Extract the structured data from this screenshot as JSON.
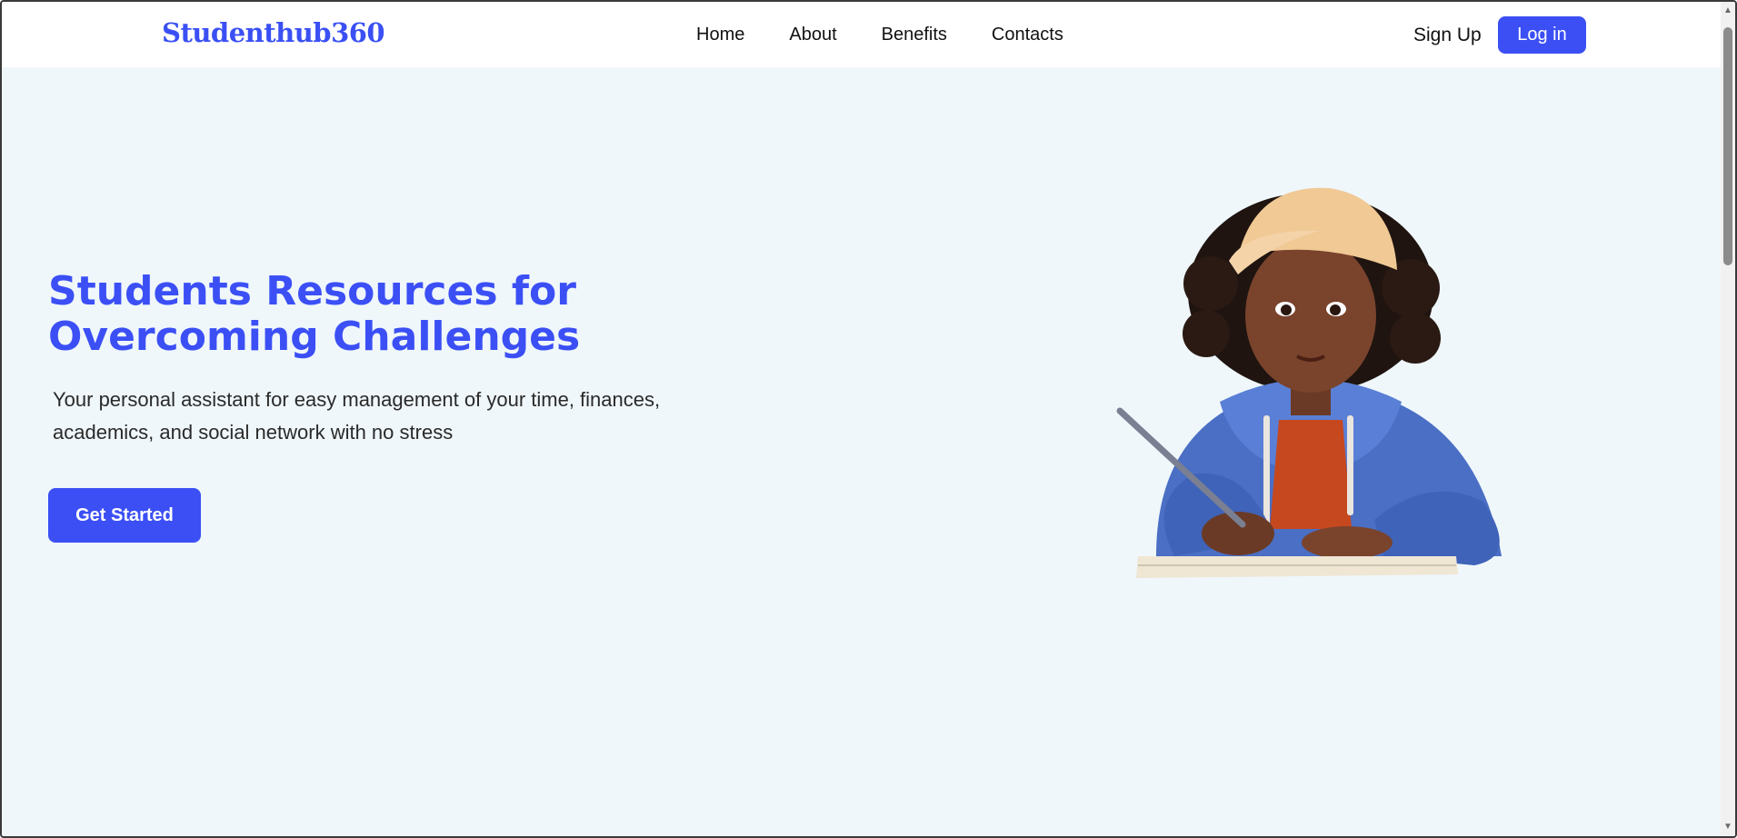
{
  "header": {
    "logo": "Studenthub360",
    "nav": [
      "Home",
      "About",
      "Benefits",
      "Contacts"
    ],
    "signup_label": "Sign Up",
    "login_label": "Log in"
  },
  "hero": {
    "title": "Students Resources for Overcoming Challenges",
    "subtitle": "Your personal assistant for easy management of your time, finances, academics, and social network with no stress",
    "cta_label": "Get Started",
    "illustration": "student-writing-illustration"
  },
  "colors": {
    "brand": "#3b4ff5",
    "page_bg": "#eff7fb",
    "header_bg": "#ffffff",
    "text": "#111111"
  }
}
